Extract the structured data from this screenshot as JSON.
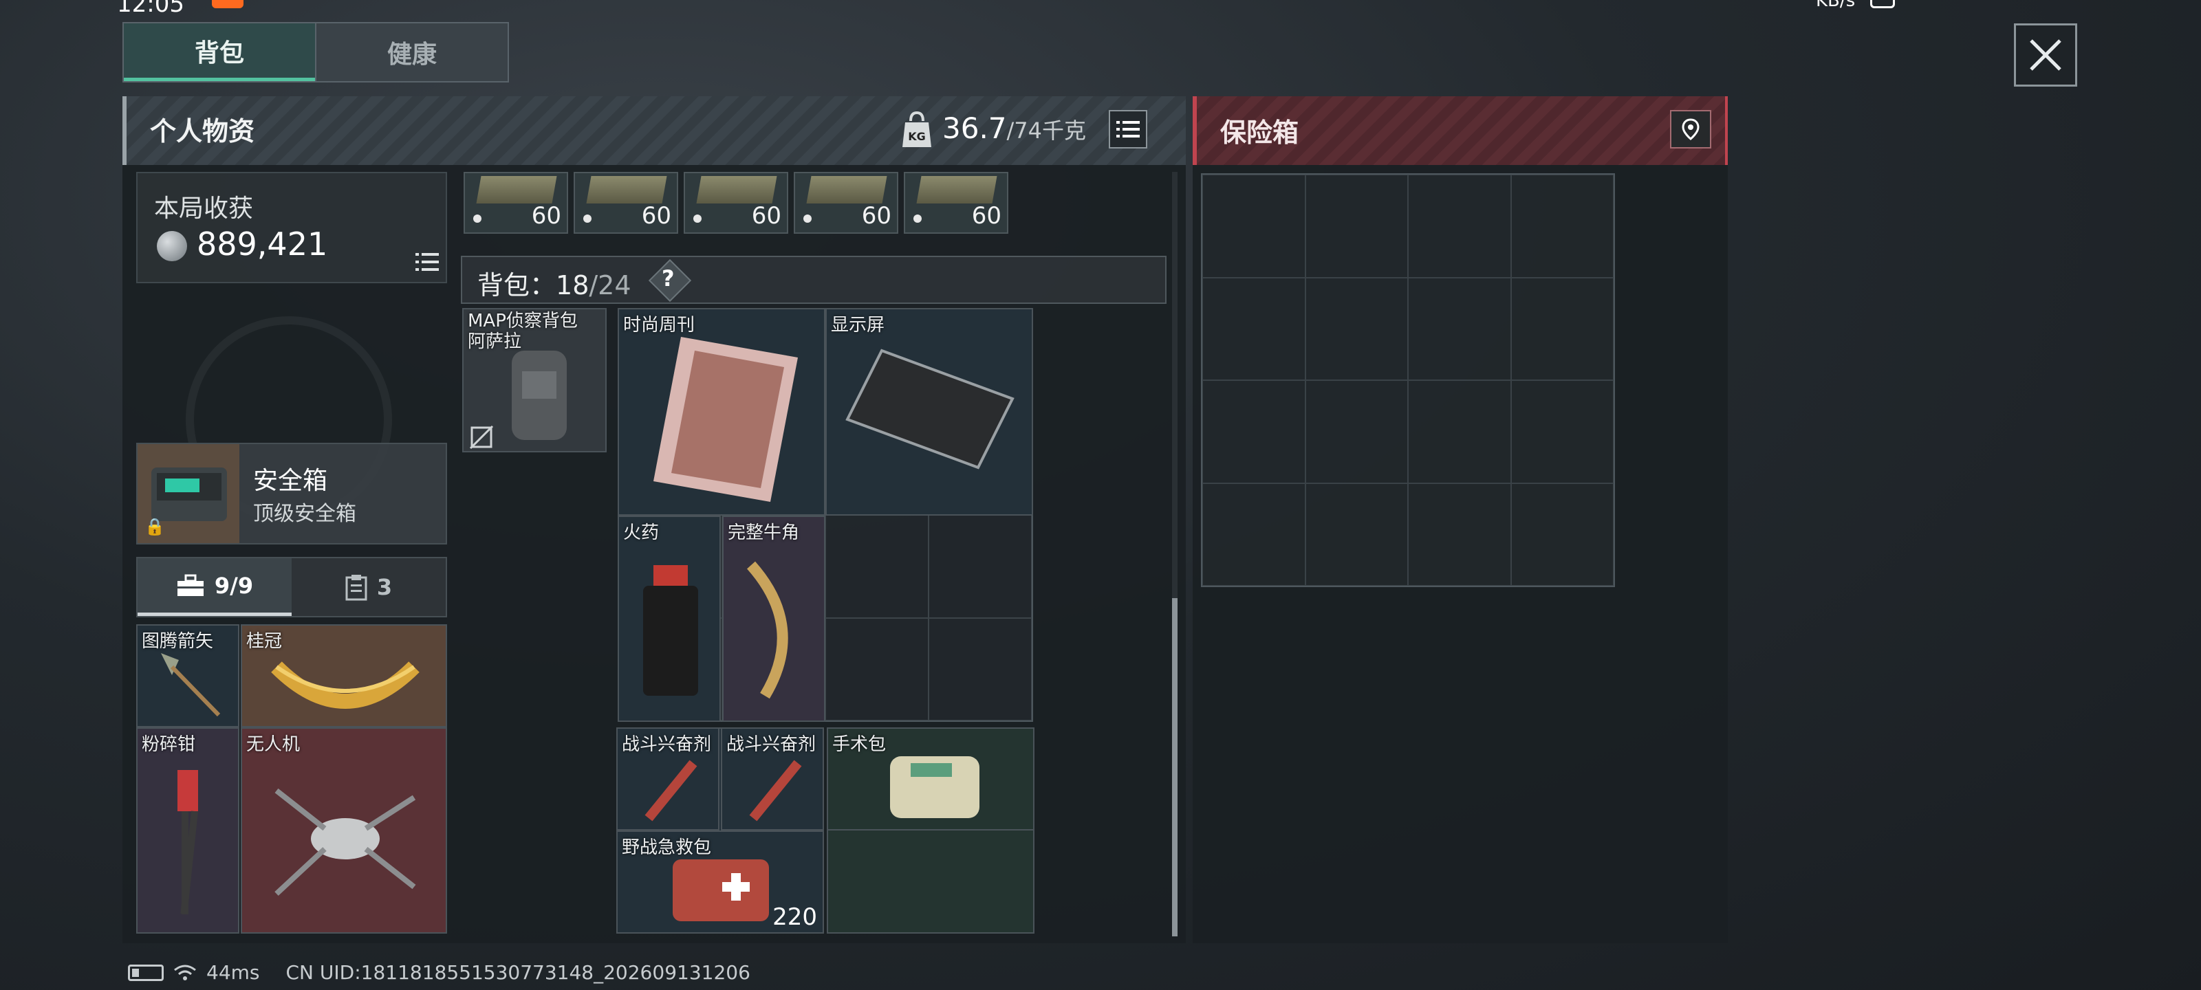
{
  "tabs": [
    {
      "label": "背包"
    },
    {
      "label": "健康"
    }
  ],
  "personal": {
    "title": "个人物资",
    "weight": "36.7",
    "weight_max": "/74千克"
  },
  "safebox_panel": {
    "title": "保险箱"
  },
  "earnings": {
    "label": "本局收获",
    "value": "889,421"
  },
  "secure_case": {
    "title": "安全箱",
    "subtitle": "顶级安全箱"
  },
  "subtabs": [
    {
      "count": "9/9",
      "icon": "toolbox-icon"
    },
    {
      "count": "3",
      "icon": "clipboard-icon"
    }
  ],
  "pouch_items": [
    {
      "label": "图腾箭矢"
    },
    {
      "label": "桂冠"
    },
    {
      "label": "粉碎钳"
    },
    {
      "label": "无人机"
    }
  ],
  "ammo": [
    {
      "count": "60"
    },
    {
      "count": "60"
    },
    {
      "count": "60"
    },
    {
      "count": "60"
    },
    {
      "count": "60"
    }
  ],
  "backpack": {
    "label": "背包：",
    "used": "18",
    "max": "/24",
    "help": "?"
  },
  "backpack_items": [
    {
      "label": "MAP侦察背包\n阿萨拉"
    },
    {
      "label": "时尚周刊"
    },
    {
      "label": "显示屏"
    },
    {
      "label": "火药"
    },
    {
      "label": "完整牛角"
    },
    {
      "label": "战斗兴奋剂"
    },
    {
      "label": "战斗兴奋剂"
    },
    {
      "label": "手术包"
    },
    {
      "label": "野战急救包",
      "count": "220"
    }
  ],
  "footer": {
    "ping": "44ms",
    "uid": "CN UID:1811818551530773148_202609131206"
  },
  "status": {
    "time": "12:05",
    "net": "KB/s"
  }
}
